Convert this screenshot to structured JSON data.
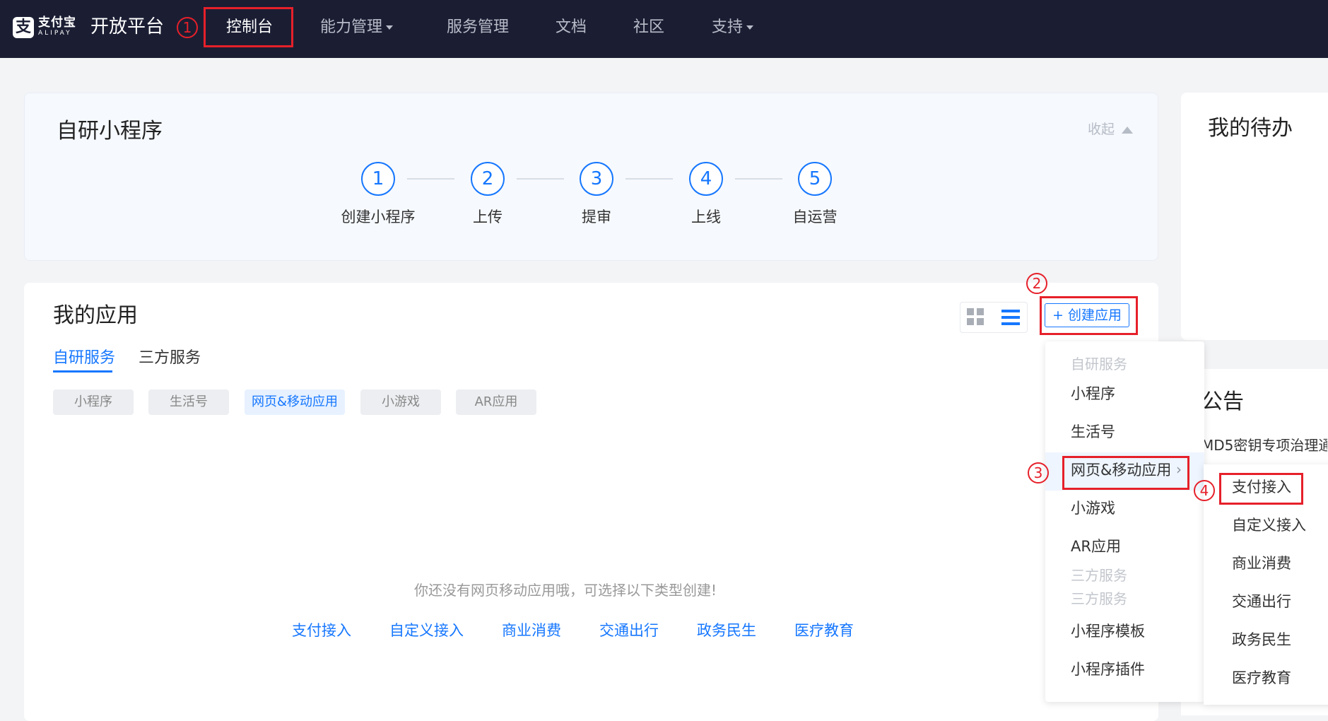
{
  "nav": {
    "logo_glyph": "支",
    "brand_name": "支付宝",
    "brand_sub": "ALIPAY",
    "platform": "开放平台",
    "items": [
      {
        "label": "控制台",
        "active": true
      },
      {
        "label": "能力管理",
        "dropdown": true
      },
      {
        "label": "服务管理"
      },
      {
        "label": "文档"
      },
      {
        "label": "社区"
      },
      {
        "label": "支持",
        "dropdown": true
      }
    ]
  },
  "annotations": {
    "one": "1",
    "two": "2",
    "three": "3",
    "four": "4"
  },
  "miniprogram": {
    "title": "自研小程序",
    "collapse_label": "收起",
    "steps": [
      {
        "num": "1",
        "label": "创建小程序"
      },
      {
        "num": "2",
        "label": "上传"
      },
      {
        "num": "3",
        "label": "提审"
      },
      {
        "num": "4",
        "label": "上线"
      },
      {
        "num": "5",
        "label": "自运营"
      }
    ]
  },
  "apps": {
    "title": "我的应用",
    "create_label": "+ 创建应用",
    "tabs": [
      {
        "label": "自研服务",
        "active": true
      },
      {
        "label": "三方服务"
      }
    ],
    "filters": [
      {
        "label": "小程序"
      },
      {
        "label": "生活号"
      },
      {
        "label": "网页&移动应用",
        "active": true
      },
      {
        "label": "小游戏"
      },
      {
        "label": "AR应用"
      }
    ],
    "empty_text": "你还没有网页移动应用哦，可选择以下类型创建!",
    "create_links": [
      "支付接入",
      "自定义接入",
      "商业消费",
      "交通出行",
      "政务民生",
      "医疗教育"
    ]
  },
  "todo": {
    "title": "我的待办"
  },
  "notice": {
    "title": "公告",
    "item": "MD5密钥专项治理通"
  },
  "create_menu": {
    "group_self": "自研服务",
    "items_self": [
      "小程序",
      "生活号",
      "网页&移动应用",
      "小游戏",
      "AR应用"
    ],
    "group_third_a": "三方服务",
    "group_third_b": "三方服务",
    "items_third": [
      "小程序模板",
      "小程序插件"
    ]
  },
  "submenu": {
    "items": [
      "支付接入",
      "自定义接入",
      "商业消费",
      "交通出行",
      "政务民生",
      "医疗教育"
    ]
  },
  "colors": {
    "primary": "#1677ff",
    "nav_bg": "#1b1e33",
    "highlight": "#e6202a"
  }
}
